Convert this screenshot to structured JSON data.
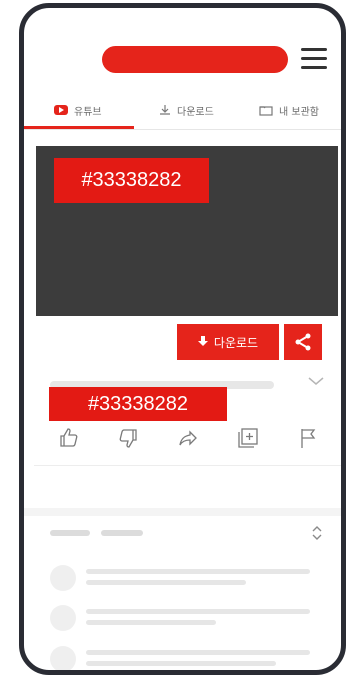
{
  "colors": {
    "accent": "#e5241b",
    "video_bg": "#3c3c3c",
    "label_bg": "#e31a14"
  },
  "labels": {
    "video_label": "#33338282",
    "title_label": "#33338282"
  },
  "tabs": [
    {
      "label": "유튜브",
      "icon": "youtube-icon"
    },
    {
      "label": "다운로드",
      "icon": "download-icon"
    },
    {
      "label": "내 보관함",
      "icon": "folder-icon"
    }
  ],
  "buttons": {
    "download": "다운로드",
    "share_icon": "share-icon"
  },
  "icons": {
    "menu": "hamburger-menu-icon",
    "like": "thumbs-up-icon",
    "dislike": "thumbs-down-icon",
    "share": "share-arrow-icon",
    "add": "add-to-playlist-icon",
    "flag": "flag-icon",
    "chevron": "chevron-down-icon",
    "sort": "sort-icon"
  }
}
